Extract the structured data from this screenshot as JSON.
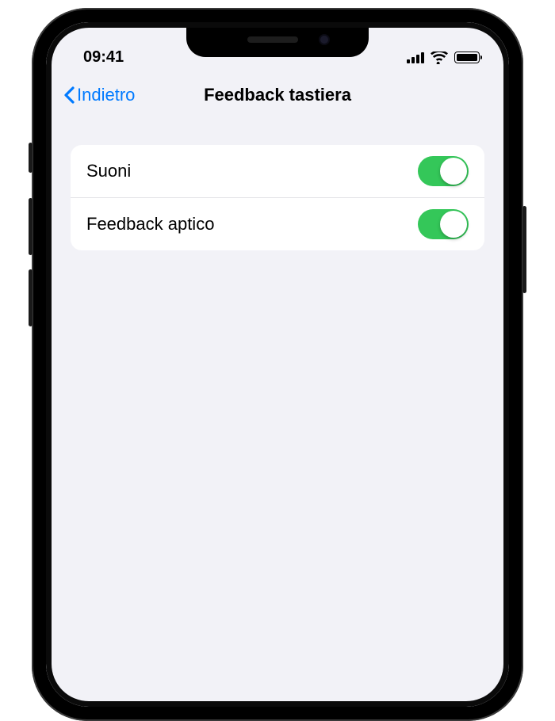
{
  "status": {
    "time": "09:41"
  },
  "nav": {
    "back_label": "Indietro",
    "title": "Feedback tastiera"
  },
  "settings": {
    "rows": [
      {
        "label": "Suoni",
        "on": true
      },
      {
        "label": "Feedback aptico",
        "on": true
      }
    ]
  },
  "colors": {
    "accent": "#007aff",
    "toggle_on": "#34c759",
    "background": "#f2f2f7"
  }
}
